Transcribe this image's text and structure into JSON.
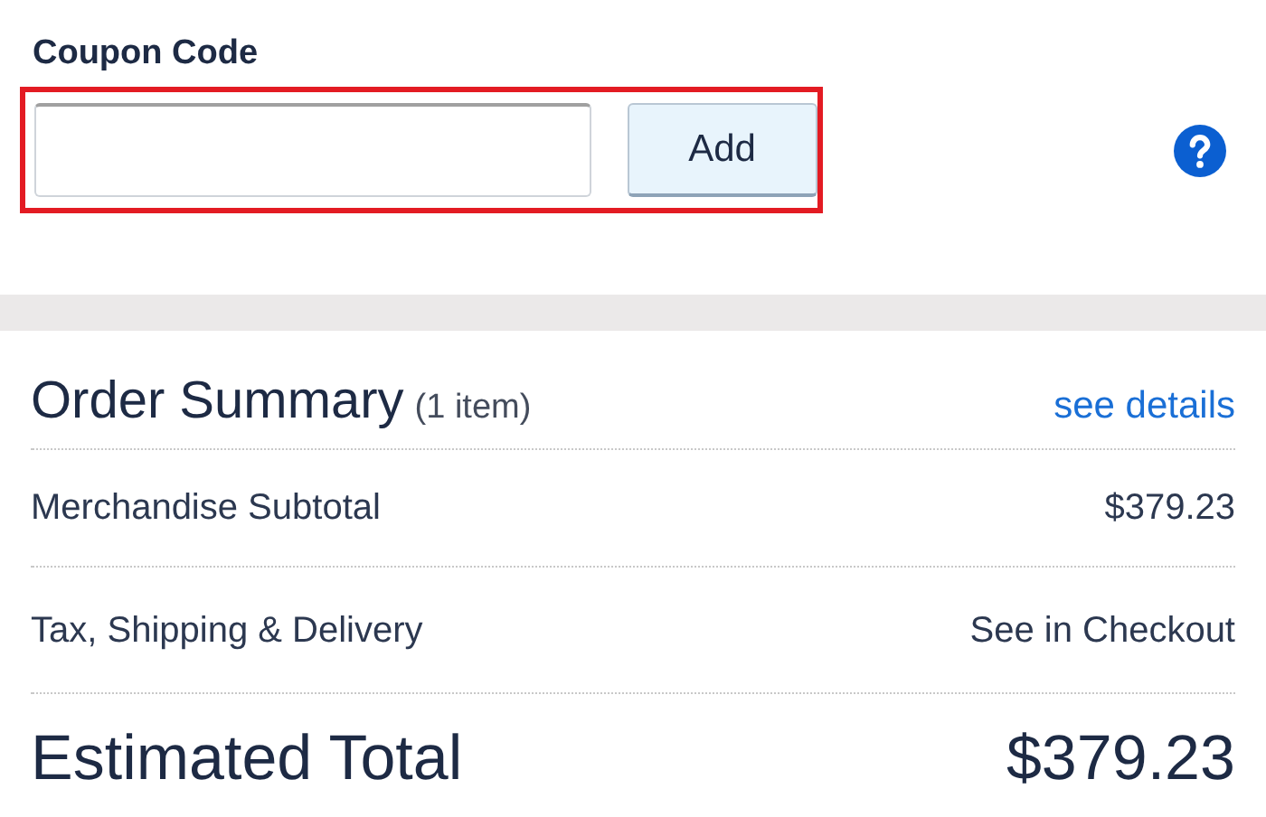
{
  "coupon": {
    "label": "Coupon Code",
    "button": "Add",
    "highlighted": true
  },
  "order_summary": {
    "title": "Order Summary",
    "count": "(1 item)",
    "link": "see details",
    "rows": [
      {
        "label": "Merchandise Subtotal",
        "value": "$379.23"
      },
      {
        "label": "Tax, Shipping & Delivery",
        "value": "See in Checkout"
      }
    ],
    "total": {
      "label": "Estimated Total",
      "value": "$379.23"
    }
  }
}
